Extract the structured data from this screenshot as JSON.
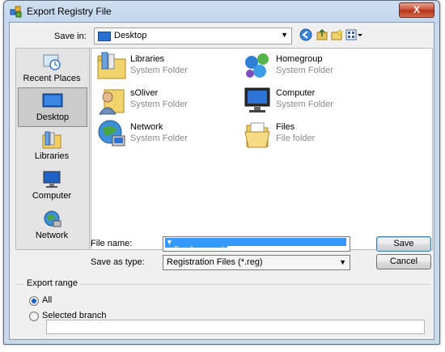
{
  "window": {
    "title": "Export Registry File",
    "close_glyph": "X"
  },
  "toolbar": {
    "save_in_label": "Save in:",
    "save_in_value": "Desktop"
  },
  "places": [
    {
      "label": "Recent Places"
    },
    {
      "label": "Desktop"
    },
    {
      "label": "Libraries"
    },
    {
      "label": "Computer"
    },
    {
      "label": "Network"
    }
  ],
  "files": [
    {
      "name": "Libraries",
      "type": "System Folder",
      "icon": "libraries-icon"
    },
    {
      "name": "Homegroup",
      "type": "System Folder",
      "icon": "homegroup-icon"
    },
    {
      "name": "sOliver",
      "type": "System Folder",
      "icon": "user-icon"
    },
    {
      "name": "Computer",
      "type": "System Folder",
      "icon": "computer-icon"
    },
    {
      "name": "Network",
      "type": "System Folder",
      "icon": "network-icon"
    },
    {
      "name": "Files",
      "type": "File folder",
      "icon": "folder-icon"
    }
  ],
  "form": {
    "file_name_label": "File name:",
    "file_name_value": "registry-backup",
    "save_as_type_label": "Save as type:",
    "save_as_type_value": "Registration Files (*.reg)",
    "save_button": "Save",
    "cancel_button": "Cancel"
  },
  "export_range": {
    "title": "Export range",
    "all_label": "All",
    "selected_label": "Selected branch",
    "selected": "All",
    "branch_value": ""
  },
  "colors": {
    "accent": "#3399ff",
    "close": "#c7492f"
  }
}
